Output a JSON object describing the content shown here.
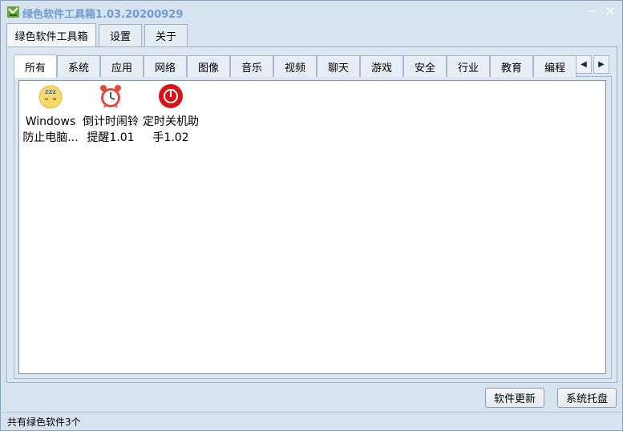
{
  "window": {
    "title": "绿色软件工具箱1.03.20200929",
    "minimize_glyph": "–",
    "close_glyph": "×"
  },
  "outer_tabs": [
    {
      "label": "绿色软件工具箱",
      "active": true
    },
    {
      "label": "设置",
      "active": false
    },
    {
      "label": "关于",
      "active": false
    }
  ],
  "inner_tabs": [
    {
      "label": "所有",
      "active": true
    },
    {
      "label": "系统"
    },
    {
      "label": "应用"
    },
    {
      "label": "网络"
    },
    {
      "label": "图像"
    },
    {
      "label": "音乐"
    },
    {
      "label": "视频"
    },
    {
      "label": "聊天"
    },
    {
      "label": "游戏"
    },
    {
      "label": "安全"
    },
    {
      "label": "行业"
    },
    {
      "label": "教育"
    },
    {
      "label": "编程"
    }
  ],
  "scroll": {
    "left_glyph": "◀",
    "right_glyph": "▶"
  },
  "apps": [
    {
      "line1": "Windows",
      "line2": "防止电脑...",
      "icon": "sleep-icon"
    },
    {
      "line1": "倒计时闹铃",
      "line2": "提醒1.01",
      "icon": "alarm-clock-icon"
    },
    {
      "line1": "定时关机助",
      "line2": "手1.02",
      "icon": "power-icon"
    }
  ],
  "buttons": {
    "update": "软件更新",
    "tray": "系统托盘"
  },
  "status": {
    "text": "共有绿色软件3个"
  },
  "colors": {
    "window_bg": "#d7e3ef",
    "title_text": "#6e9bd1",
    "power_red": "#d8141b",
    "sleep_yellow": "#f6d96b"
  }
}
